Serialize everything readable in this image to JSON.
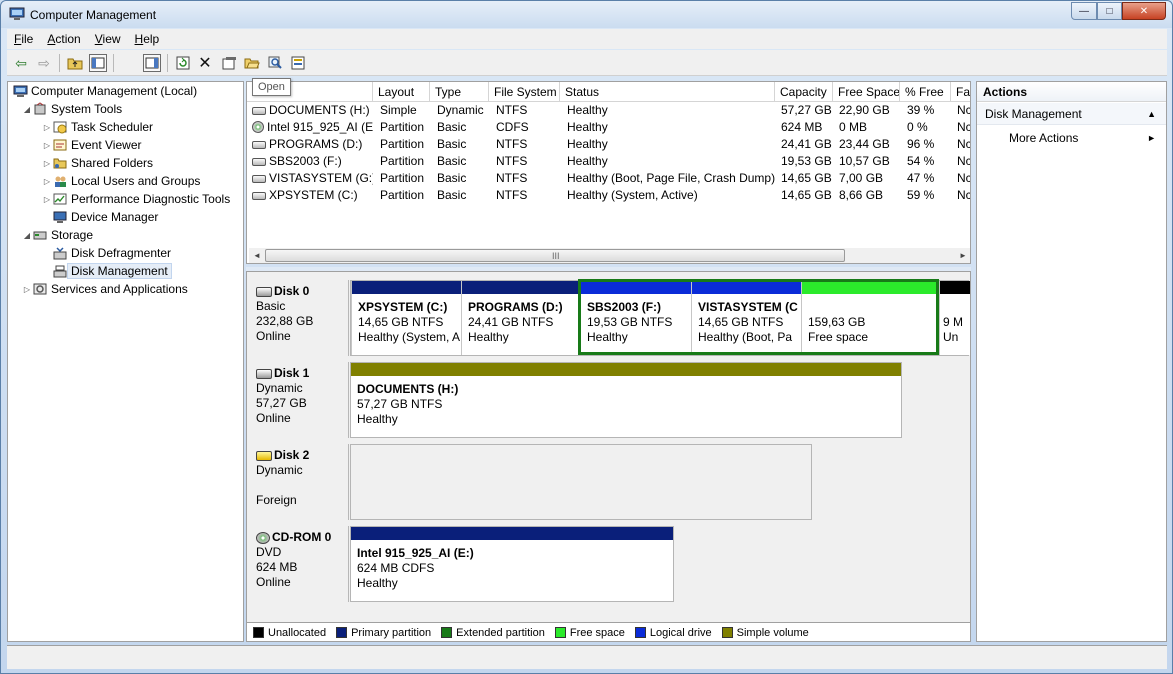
{
  "window": {
    "title": "Computer Management",
    "minimize_glyph": "—",
    "maximize_glyph": "□",
    "close_glyph": "✕"
  },
  "menu": {
    "file_prefix": "",
    "file_key": "F",
    "file_rest": "ile",
    "action_prefix": "",
    "action_key": "A",
    "action_rest": "ction",
    "view_prefix": "",
    "view_key": "V",
    "view_rest": "iew",
    "help_prefix": "",
    "help_key": "H",
    "help_rest": "elp"
  },
  "toolbar": {
    "back_glyph": "⇦",
    "forward_glyph": "⇨",
    "tooltip": "Open"
  },
  "tree": {
    "root": "Computer Management (Local)",
    "system_tools": "System Tools",
    "task_scheduler": "Task Scheduler",
    "event_viewer": "Event Viewer",
    "shared_folders": "Shared Folders",
    "local_users": "Local Users and Groups",
    "perf_tools": "Performance Diagnostic Tools",
    "device_manager": "Device Manager",
    "storage": "Storage",
    "disk_defrag": "Disk Defragmenter",
    "disk_mgmt": "Disk Management",
    "services": "Services and Applications"
  },
  "volumes": {
    "columns": {
      "volume": "",
      "layout": "Layout",
      "type": "Type",
      "fs": "File System",
      "status": "Status",
      "capacity": "Capacity",
      "free": "Free Space",
      "pct": "% Free",
      "fault": "Fa"
    },
    "rows": [
      {
        "volume": "DOCUMENTS (H:)",
        "layout": "Simple",
        "type": "Dynamic",
        "fs": "NTFS",
        "status": "Healthy",
        "capacity": "57,27 GB",
        "free": "22,90 GB",
        "pct": "39 %",
        "fault": "Nc"
      },
      {
        "volume": "Intel 915_925_AI (E:)",
        "layout": "Partition",
        "type": "Basic",
        "fs": "CDFS",
        "status": "Healthy",
        "capacity": "624 MB",
        "free": "0 MB",
        "pct": "0 %",
        "fault": "Nc"
      },
      {
        "volume": "PROGRAMS (D:)",
        "layout": "Partition",
        "type": "Basic",
        "fs": "NTFS",
        "status": "Healthy",
        "capacity": "24,41 GB",
        "free": "23,44 GB",
        "pct": "96 %",
        "fault": "Nc"
      },
      {
        "volume": "SBS2003 (F:)",
        "layout": "Partition",
        "type": "Basic",
        "fs": "NTFS",
        "status": "Healthy",
        "capacity": "19,53 GB",
        "free": "10,57 GB",
        "pct": "54 %",
        "fault": "Nc"
      },
      {
        "volume": "VISTASYSTEM (G:)",
        "layout": "Partition",
        "type": "Basic",
        "fs": "NTFS",
        "status": "Healthy (Boot, Page File, Crash Dump)",
        "capacity": "14,65 GB",
        "free": "7,00 GB",
        "pct": "47 %",
        "fault": "Nc"
      },
      {
        "volume": "XPSYSTEM (C:)",
        "layout": "Partition",
        "type": "Basic",
        "fs": "NTFS",
        "status": "Healthy (System, Active)",
        "capacity": "14,65 GB",
        "free": "8,66 GB",
        "pct": "59 %",
        "fault": "Nc"
      }
    ],
    "scroll_grip": "III"
  },
  "disks": {
    "disk0": {
      "name": "Disk 0",
      "type": "Basic",
      "size": "232,88 GB",
      "status": "Online",
      "parts": {
        "p1": {
          "name": "XPSYSTEM  (C:)",
          "size": "14,65 GB NTFS",
          "status": "Healthy (System, A"
        },
        "p2": {
          "name": "PROGRAMS  (D:)",
          "size": "24,41 GB NTFS",
          "status": "Healthy"
        },
        "p3": {
          "name": "SBS2003  (F:)",
          "size": "19,53 GB NTFS",
          "status": "Healthy"
        },
        "p4": {
          "name": "VISTASYSTEM  (C",
          "size": "14,65 GB NTFS",
          "status": "Healthy (Boot, Pa"
        },
        "p5": {
          "name": "",
          "size": "159,63 GB",
          "status": "Free space"
        },
        "p6": {
          "name": "",
          "size": "9 M",
          "status": "Un"
        }
      }
    },
    "disk1": {
      "name": "Disk 1",
      "type": "Dynamic",
      "size": "57,27 GB",
      "status": "Online",
      "part": {
        "name": "DOCUMENTS  (H:)",
        "size": "57,27 GB NTFS",
        "status": "Healthy"
      }
    },
    "disk2": {
      "name": "Disk 2",
      "type": "Dynamic",
      "status": "Foreign"
    },
    "cdrom0": {
      "name": "CD-ROM 0",
      "type": "DVD",
      "size": "624 MB",
      "status": "Online",
      "part": {
        "name": "Intel 915_925_AI  (E:)",
        "size": "624 MB CDFS",
        "status": "Healthy"
      }
    }
  },
  "legend": {
    "unallocated": "Unallocated",
    "primary": "Primary partition",
    "extended": "Extended partition",
    "free": "Free space",
    "logical": "Logical drive",
    "simple": "Simple volume"
  },
  "colors": {
    "primary": "#0a1f7a",
    "logical": "#0a2bd8",
    "free": "#2bea2b",
    "extended": "#187a18",
    "simple": "#808000",
    "unallocated": "#000000"
  },
  "actions": {
    "header": "Actions",
    "section": "Disk Management",
    "more": "More Actions",
    "up_arrow": "▲",
    "right_arrow": "►"
  }
}
